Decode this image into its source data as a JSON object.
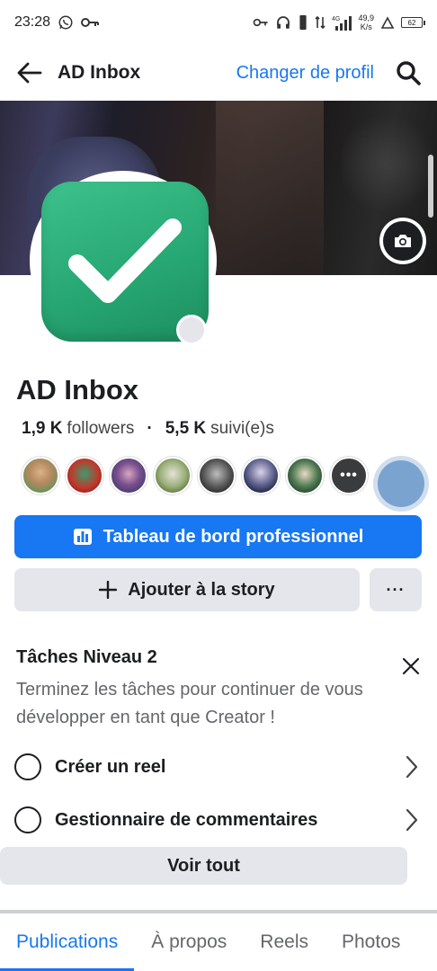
{
  "status_bar": {
    "time": "23:28",
    "network_speed": "49,9",
    "network_speed_unit": "K/s",
    "signal_label": "4G",
    "battery": "62",
    "icons": [
      "whatsapp-icon",
      "key-icon",
      "key-icon",
      "headphones-icon",
      "vibrate-icon",
      "data-arrows-icon",
      "signal-icon",
      "wifi-off-icon",
      "battery-icon"
    ]
  },
  "nav": {
    "title": "AD Inbox",
    "switch_profile": "Changer de profil"
  },
  "profile": {
    "name": "AD Inbox",
    "followers_count": "1,9 K",
    "followers_label": "followers",
    "separator": "·",
    "following_count": "5,5 K",
    "following_label": "suivi(e)s",
    "more_friends": "•••"
  },
  "buttons": {
    "dashboard": "Tableau de bord professionnel",
    "add_story": "Ajouter à la story",
    "more": "···"
  },
  "tasks": {
    "title": "Tâches Niveau 2",
    "description": "Terminez les tâches pour continuer de vous développer en tant que Creator !",
    "items": [
      {
        "label": "Créer un reel"
      },
      {
        "label": "Gestionnaire de commentaires"
      }
    ],
    "see_all": "Voir tout"
  },
  "tabs": [
    {
      "label": "Publications",
      "active": true
    },
    {
      "label": "À propos"
    },
    {
      "label": "Reels"
    },
    {
      "label": "Photos"
    }
  ],
  "colors": {
    "accent": "#1877f2",
    "avatar_green": "#27a874",
    "button_grey": "#e4e6eb",
    "secondary_text": "#65676b"
  }
}
